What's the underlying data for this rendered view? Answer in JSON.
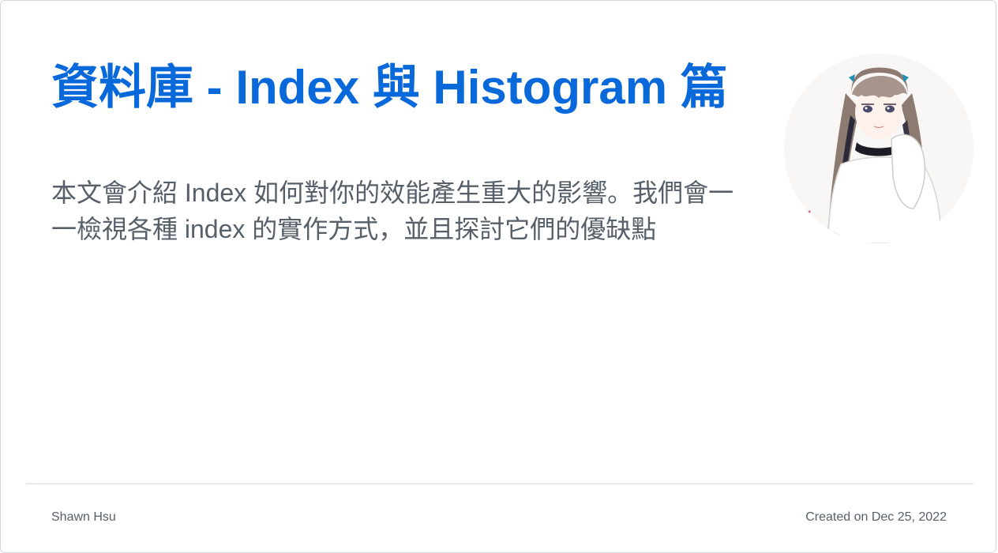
{
  "card": {
    "title": "資料庫 - Index 與 Histogram 篇",
    "description": "本文會介紹 Index 如何對你的效能產生重大的影響。我們會一一檢視各種 index 的實作方式，並且探討它們的優缺點",
    "avatar_icon": "anime-girl-avatar",
    "footer": {
      "author": "Shawn Hsu",
      "created": "Created on Dec 25, 2022"
    }
  },
  "colors": {
    "title": "#0969da",
    "text": "#57606a",
    "divider": "#d8dee4"
  }
}
